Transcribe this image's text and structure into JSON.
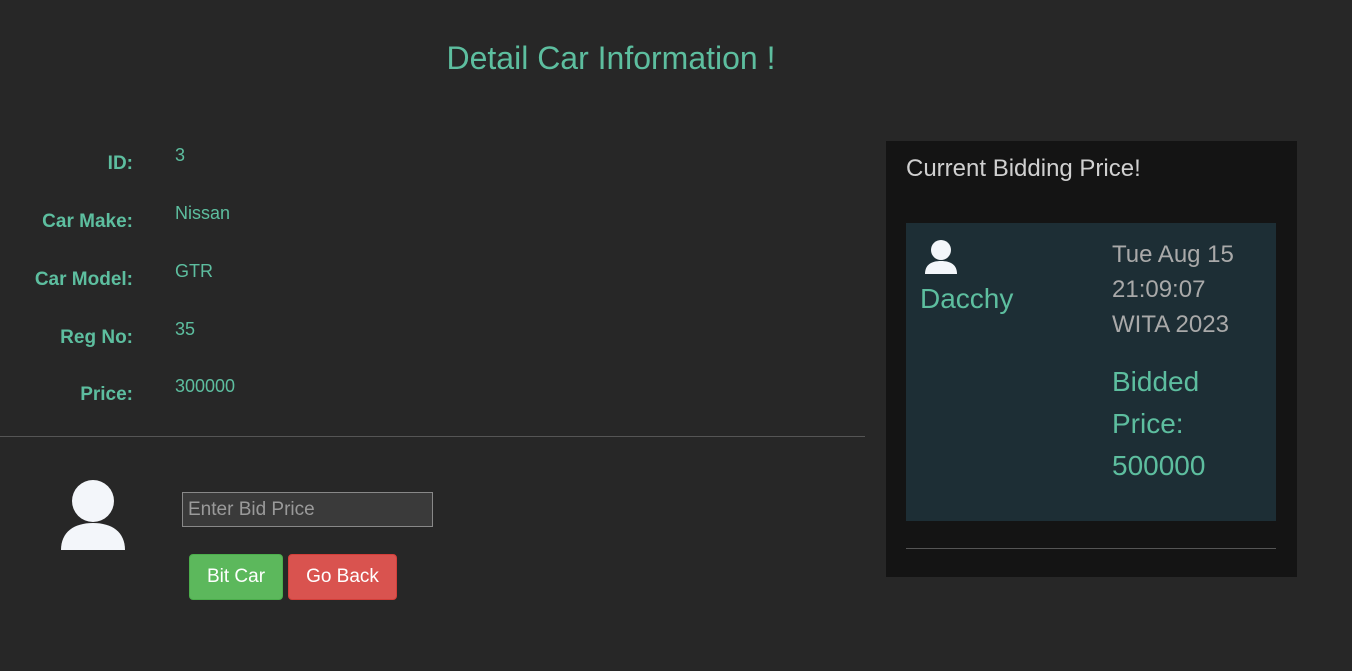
{
  "page": {
    "title": "Detail Car Information !"
  },
  "details": [
    {
      "label": "ID:",
      "value": "3"
    },
    {
      "label": "Car Make:",
      "value": "Nissan"
    },
    {
      "label": "Car Model:",
      "value": "GTR"
    },
    {
      "label": "Reg No:",
      "value": "35"
    },
    {
      "label": "Price:",
      "value": "300000"
    }
  ],
  "bid_form": {
    "avatar_icon": "user-icon",
    "input_placeholder": "Enter Bid Price",
    "input_value": "",
    "bid_button": "Bit Car",
    "back_button": "Go Back"
  },
  "bidding_panel": {
    "title": "Current Bidding Price!",
    "bids": [
      {
        "avatar_icon": "user-icon",
        "bidder": "Dacchy",
        "date": "Tue Aug 15 21:09:07 WITA 2023",
        "price_label": "Bidded Price: 500000"
      }
    ]
  },
  "colors": {
    "background": "#272727",
    "accent": "#5dbe9f",
    "panel": "#141414",
    "card": "#1d2e35",
    "success": "#5cb85c",
    "danger": "#d9534f"
  }
}
